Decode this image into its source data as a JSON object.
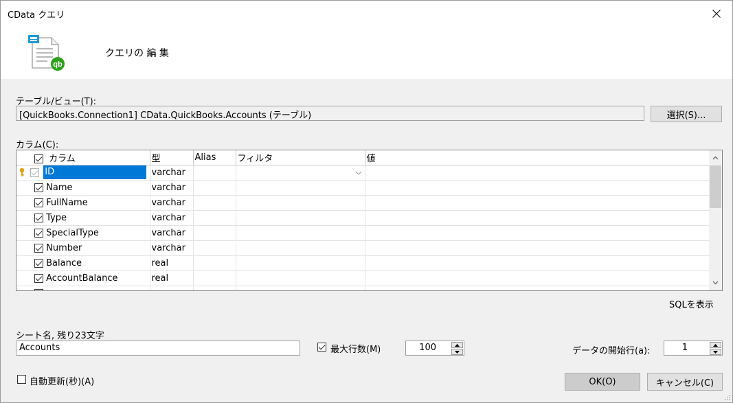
{
  "window": {
    "title": "CData クエリ"
  },
  "header": {
    "title": "クエリの 編 集"
  },
  "table_view": {
    "label": "テーブル/ビュー(T):",
    "value": "[QuickBooks.Connection1] CData.QuickBooks.Accounts (テーブル)",
    "select_button": "選択(S)..."
  },
  "columns": {
    "label": "カラム(C):",
    "headers": [
      "カラム",
      "型",
      "Alias",
      "フィルタ",
      "値"
    ],
    "rows": [
      {
        "name": "ID",
        "type": "varchar",
        "key": true
      },
      {
        "name": "Name",
        "type": "varchar"
      },
      {
        "name": "FullName",
        "type": "varchar"
      },
      {
        "name": "Type",
        "type": "varchar"
      },
      {
        "name": "SpecialType",
        "type": "varchar"
      },
      {
        "name": "Number",
        "type": "varchar"
      },
      {
        "name": "Balance",
        "type": "real"
      },
      {
        "name": "AccountBalance",
        "type": "real"
      }
    ]
  },
  "show_sql": "SQLを表示",
  "sheet": {
    "label": "シート名, 残り23文字",
    "value": "Accounts"
  },
  "max_rows": {
    "label": "最大行数(M)",
    "value": "100"
  },
  "start_row": {
    "label": "データの開始行(a):",
    "value": "1"
  },
  "auto_refresh": {
    "label": "自動更新(秒)(A)"
  },
  "ok_button": "OK(O)",
  "cancel_button": "キャンセル(C)",
  "colors": {
    "accent": "#0078d7",
    "header_bg": "#ffffff",
    "body_bg": "#f0f0f0",
    "qb_green": "#2ca01c"
  }
}
